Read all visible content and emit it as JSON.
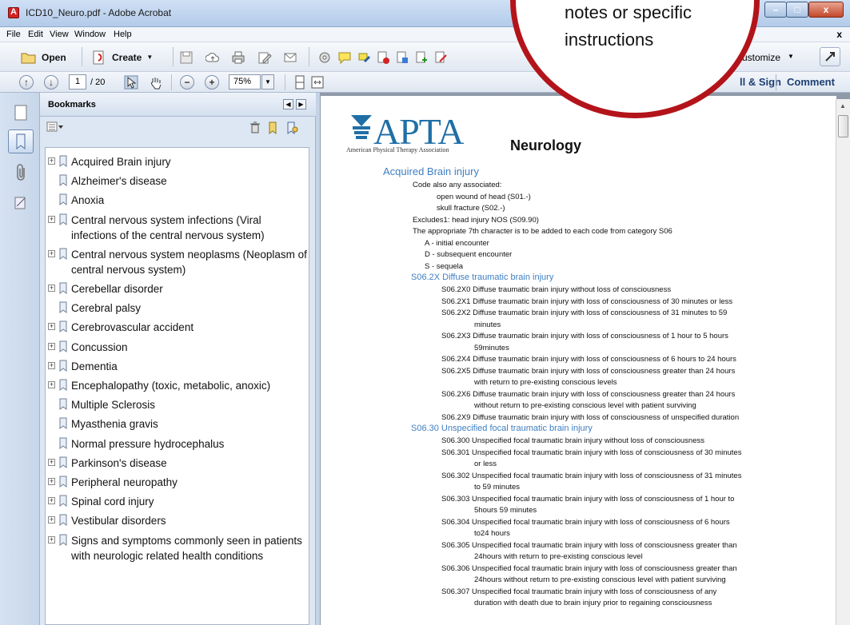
{
  "window": {
    "title": "ICD10_Neuro.pdf - Adobe Acrobat",
    "min_glyph": "–",
    "max_glyph": "□",
    "close_glyph": "x"
  },
  "menu": {
    "items": [
      "File",
      "Edit",
      "View",
      "Window",
      "Help"
    ],
    "close_glyph": "x"
  },
  "toolbar": {
    "open_label": "Open",
    "create_label": "Create",
    "customize_label": "ustomize",
    "page_current": "1",
    "page_total": "/ 20",
    "zoom": "75%",
    "fill_sign_label": "ll & Sign",
    "comment_label": "Comment"
  },
  "callout": {
    "line1": "notes or specific",
    "line2": "instructions"
  },
  "bookmarks": {
    "title": "Bookmarks",
    "items": [
      {
        "label": "Acquired Brain injury",
        "expandable": true
      },
      {
        "label": "Alzheimer's disease",
        "expandable": false
      },
      {
        "label": "Anoxia",
        "expandable": false
      },
      {
        "label": "Central nervous system infections (Viral infections of the central nervous system)",
        "expandable": true
      },
      {
        "label": "Central nervous system neoplasms (Neoplasm of central nervous system)",
        "expandable": true
      },
      {
        "label": "Cerebellar disorder",
        "expandable": true
      },
      {
        "label": "Cerebral palsy",
        "expandable": false
      },
      {
        "label": "Cerebrovascular accident",
        "expandable": true
      },
      {
        "label": "Concussion",
        "expandable": true
      },
      {
        "label": "Dementia",
        "expandable": true
      },
      {
        "label": "Encephalopathy (toxic, metabolic, anoxic)",
        "expandable": true
      },
      {
        "label": "Multiple Sclerosis",
        "expandable": false
      },
      {
        "label": "Myasthenia gravis",
        "expandable": false
      },
      {
        "label": "Normal pressure hydrocephalus",
        "expandable": false
      },
      {
        "label": "Parkinson's disease",
        "expandable": true
      },
      {
        "label": "Peripheral neuropathy",
        "expandable": true
      },
      {
        "label": "Spinal cord injury",
        "expandable": true
      },
      {
        "label": "Vestibular disorders",
        "expandable": true
      },
      {
        "label": "Signs and symptoms commonly seen in patients with neurologic related health conditions",
        "expandable": true
      }
    ]
  },
  "document": {
    "logo_text": "APTA",
    "logo_subtitle": "American Physical Therapy Association",
    "page_title": "Neurology",
    "section_title": "Acquired Brain injury",
    "intro_lines": [
      "Code also any associated:",
      "open wound of head (S01.-)",
      "skull fracture (S02.-)",
      "Excludes1: head injury NOS (S09.90)",
      "The appropriate 7th character is to be added to each code from category S06",
      "A - initial encounter",
      "D - subsequent encounter",
      "S - sequela"
    ],
    "subsections": [
      {
        "heading": "S06.2X Diffuse traumatic brain injury",
        "codes": [
          [
            "S06.2X0 Diffuse traumatic brain injury without loss of consciousness"
          ],
          [
            "S06.2X1 Diffuse traumatic brain injury with loss of consciousness of 30 minutes or less"
          ],
          [
            "S06.2X2 Diffuse traumatic brain injury with loss of consciousness of 31 minutes to 59",
            "minutes"
          ],
          [
            "S06.2X3 Diffuse traumatic brain injury with loss of consciousness of 1 hour to 5 hours",
            "59minutes"
          ],
          [
            "S06.2X4 Diffuse traumatic brain injury with loss of consciousness of 6 hours to 24 hours"
          ],
          [
            "S06.2X5 Diffuse traumatic brain injury with loss of consciousness greater than 24 hours",
            "with return to pre-existing conscious levels"
          ],
          [
            "S06.2X6 Diffuse traumatic brain injury with loss of consciousness greater than 24 hours",
            "without return to pre-existing conscious level with patient surviving"
          ],
          [
            "S06.2X9 Diffuse traumatic brain injury with loss of consciousness of unspecified duration"
          ]
        ]
      },
      {
        "heading": "S06.30 Unspecified focal traumatic brain injury",
        "codes": [
          [
            "S06.300 Unspecified focal traumatic brain injury without loss of consciousness"
          ],
          [
            "S06.301 Unspecified focal traumatic brain injury with loss of consciousness of 30 minutes",
            "or less"
          ],
          [
            "S06.302 Unspecified focal traumatic brain injury with loss of consciousness of 31 minutes",
            "to 59 minutes"
          ],
          [
            "S06.303 Unspecified focal traumatic brain injury with loss of consciousness of 1 hour to",
            "5hours 59 minutes"
          ],
          [
            "S06.304 Unspecified focal traumatic brain injury with loss of consciousness of 6 hours",
            "to24 hours"
          ],
          [
            "S06.305 Unspecified focal traumatic brain injury with loss of consciousness greater than",
            "24hours with return to pre-existing conscious level"
          ],
          [
            "S06.306 Unspecified focal traumatic brain injury with loss of consciousness greater than",
            "24hours without return to pre-existing conscious level with patient surviving"
          ],
          [
            "S06.307 Unspecified focal traumatic brain injury with loss of consciousness of any",
            "duration with death due to brain injury prior to regaining consciousness"
          ]
        ]
      }
    ]
  }
}
